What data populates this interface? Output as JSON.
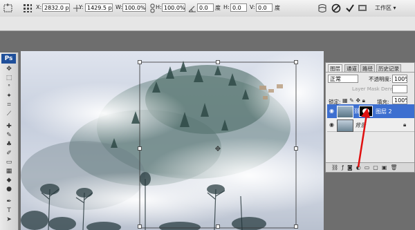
{
  "options": {
    "x_label": "X:",
    "x_value": "2832.0 px",
    "y_label": "Y:",
    "y_value": "1429.5 px",
    "w_label": "W:",
    "w_value": "100.0%",
    "h_label": "H:",
    "h_value": "100.0%",
    "angle_value": "0.0",
    "degree_unit": "度",
    "hskew_label": "H:",
    "hskew_value": "0.0",
    "vskew_label": "V:",
    "vskew_value": "0.0",
    "degree_unit_2": "度",
    "workspace_label": "工作区 ▾"
  },
  "toolbox": {
    "logo": "Ps"
  },
  "layers_panel": {
    "tabs": [
      "图层",
      "通道",
      "路径",
      "历史记录"
    ],
    "blend_mode": "正常",
    "opacity_label": "不透明度:",
    "opacity_value": "100%",
    "mask_density_label": "Layer Mask Density",
    "lock_label": "锁定:",
    "fill_label": "填充:",
    "fill_value": "100%",
    "layers": [
      {
        "name": "图层 2",
        "selected": true
      },
      {
        "name": "背景",
        "selected": false
      }
    ]
  },
  "colors": {
    "selection": "#3d6fd0",
    "arrow": "#e01010"
  }
}
